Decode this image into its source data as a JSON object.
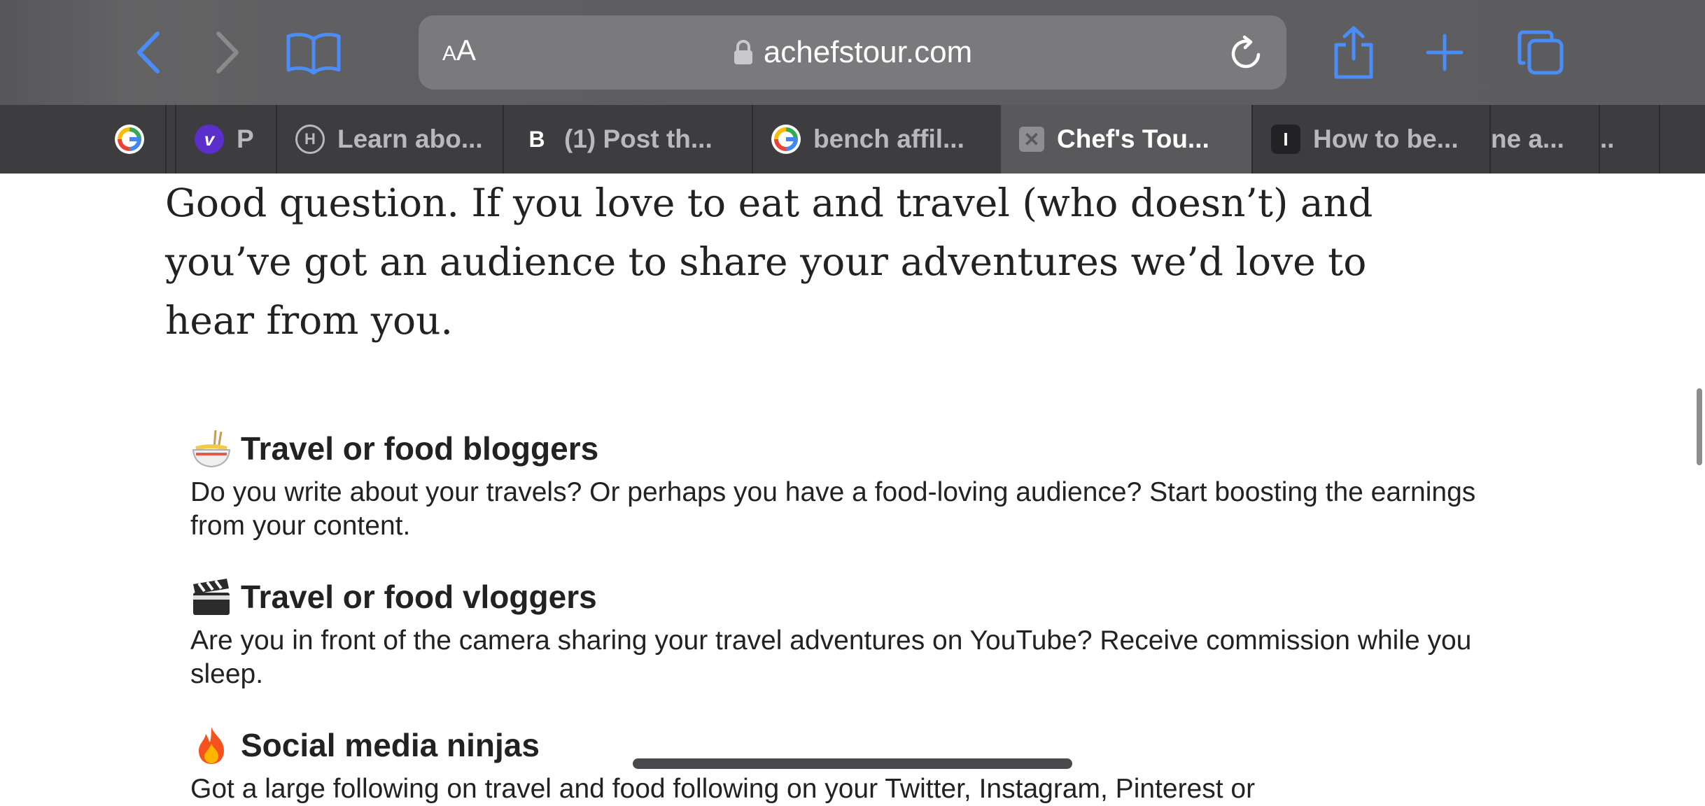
{
  "browser": {
    "address_bar": {
      "text_size_label_small": "A",
      "text_size_label_big": "A",
      "url": "achefstour.com"
    },
    "tabs": [
      {
        "label": "",
        "icon": "google-icon"
      },
      {
        "label": "",
        "icon": "google-icon"
      },
      {
        "label": "P",
        "icon": "v-logo-icon"
      },
      {
        "label": "Learn abo...",
        "icon": "h-logo-icon"
      },
      {
        "label": "(1) Post th...",
        "icon": "b-logo-icon"
      },
      {
        "label": "bench affil...",
        "icon": "google-icon"
      },
      {
        "label": "Chef's Tou...",
        "icon": "close-icon",
        "active": true
      },
      {
        "label": "How to be...",
        "icon": "i-logo-icon"
      },
      {
        "label": "ne a...",
        "icon": ""
      },
      {
        "label": "..",
        "icon": ""
      }
    ]
  },
  "article": {
    "intro": "Good question. If you love to eat and travel (who doesn’t) and you’ve got an audience to share your adventures we’d love to hear from you.",
    "sections": [
      {
        "icon": "noodle-bowl-icon",
        "heading": "Travel or food bloggers",
        "body": "Do you write about your travels? Or perhaps you have a food-loving audience? Start boosting the earnings from your content."
      },
      {
        "icon": "clapperboard-icon",
        "heading": "Travel or food vloggers",
        "body": "Are you in front of the camera sharing your travel adventures on YouTube? Receive commission while you sleep."
      },
      {
        "icon": "fire-icon",
        "heading": "Social media ninjas",
        "body": "Got a large following on travel and food following on your Twitter, Instagram, Pinterest or"
      }
    ]
  },
  "colors": {
    "accent": "#4a8df8",
    "toolbar": "#5f5f61",
    "tabbar": "#3d3d3f",
    "text": "#222222"
  }
}
